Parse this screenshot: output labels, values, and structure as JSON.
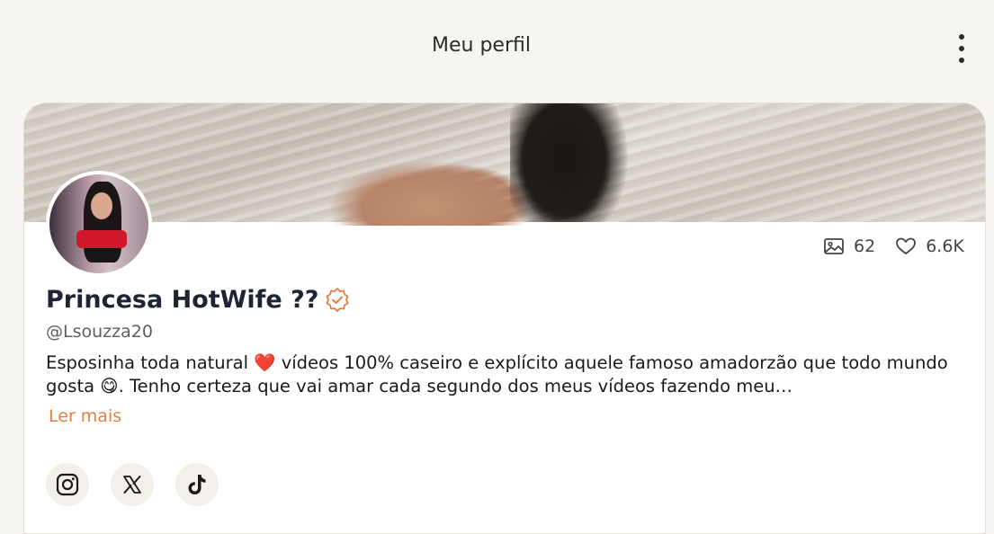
{
  "header": {
    "title": "Meu perfil",
    "menu_icon": "more-vertical-icon"
  },
  "profile": {
    "name": "Princesa HotWife ??",
    "verified_icon": "verified-badge-icon",
    "handle": "@Lsouzza20",
    "bio": "Esposinha toda natural ❤️ vídeos 100% caseiro e explícito aquele famoso amadorzão que todo mundo gosta 😋. Tenho certeza que vai amar cada segundo dos meus vídeos fazendo meu…",
    "read_more_label": "Ler mais",
    "stats": {
      "media_count": "62",
      "likes_count": "6.6K"
    },
    "socials": [
      {
        "icon": "instagram-icon"
      },
      {
        "icon": "x-twitter-icon"
      },
      {
        "icon": "tiktok-icon"
      }
    ]
  },
  "colors": {
    "accent": "#e07f3e",
    "verified": "#e07f3e",
    "name": "#1d2433",
    "background": "#f7f5f1"
  }
}
